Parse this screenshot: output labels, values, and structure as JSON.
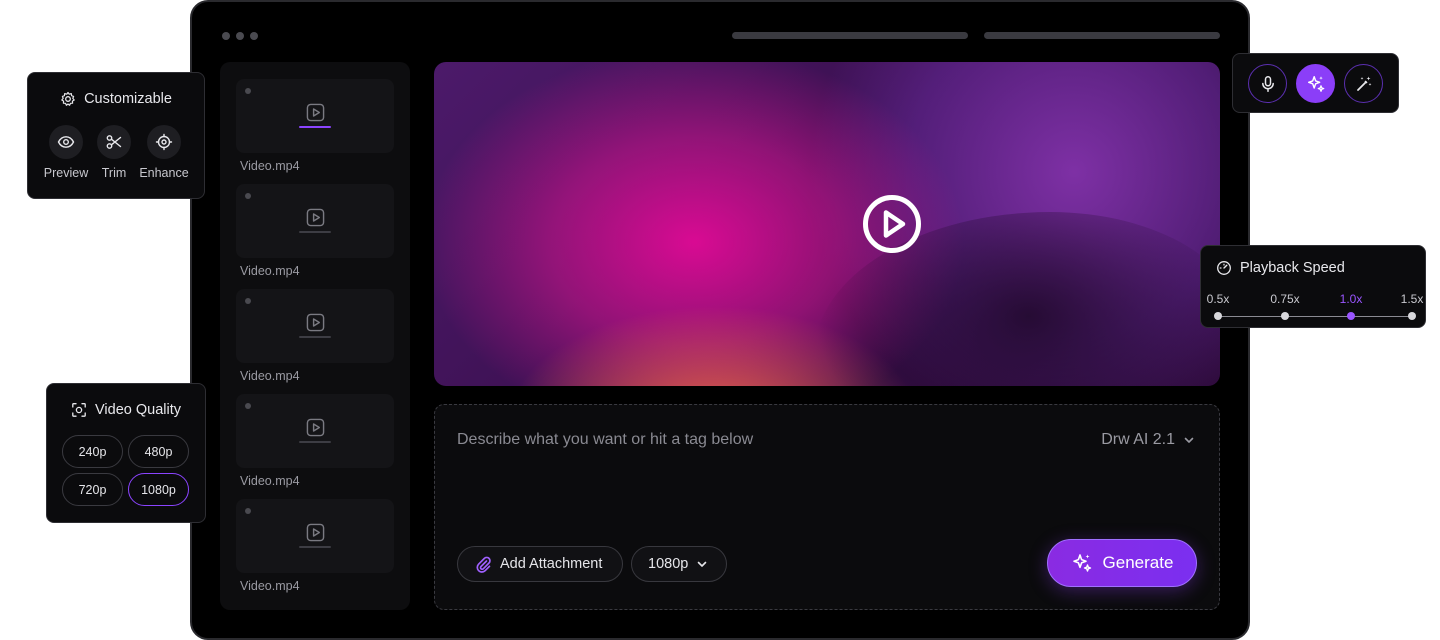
{
  "sidebar": {
    "files": [
      {
        "name": "Video.mp4",
        "active": true
      },
      {
        "name": "Video.mp4",
        "active": false
      },
      {
        "name": "Video.mp4",
        "active": false
      },
      {
        "name": "Video.mp4",
        "active": false
      },
      {
        "name": "Video.mp4",
        "active": false
      }
    ]
  },
  "prompt": {
    "placeholder": "Describe what you want or hit a tag below",
    "model": "Drw AI 2.1",
    "attachment_label": "Add Attachment",
    "resolution": "1080p",
    "generate_label": "Generate"
  },
  "customizable": {
    "title": "Customizable",
    "tools": [
      {
        "label": "Preview",
        "icon": "eye-icon"
      },
      {
        "label": "Trim",
        "icon": "scissors-icon"
      },
      {
        "label": "Enhance",
        "icon": "crosshair-icon"
      }
    ]
  },
  "quality": {
    "title": "Video Quality",
    "options": [
      "240p",
      "480p",
      "720p",
      "1080p"
    ],
    "selected": "1080p"
  },
  "playback": {
    "title": "Playback Speed",
    "speeds": [
      "0.5x",
      "0.75x",
      "1.0x",
      "1.5x"
    ],
    "selected": "1.0x"
  },
  "actions": {
    "icons": [
      "microphone-icon",
      "sparkles-icon",
      "magic-wand-icon"
    ]
  },
  "colors": {
    "accent": "#8b3ef8",
    "background": "#000000"
  }
}
